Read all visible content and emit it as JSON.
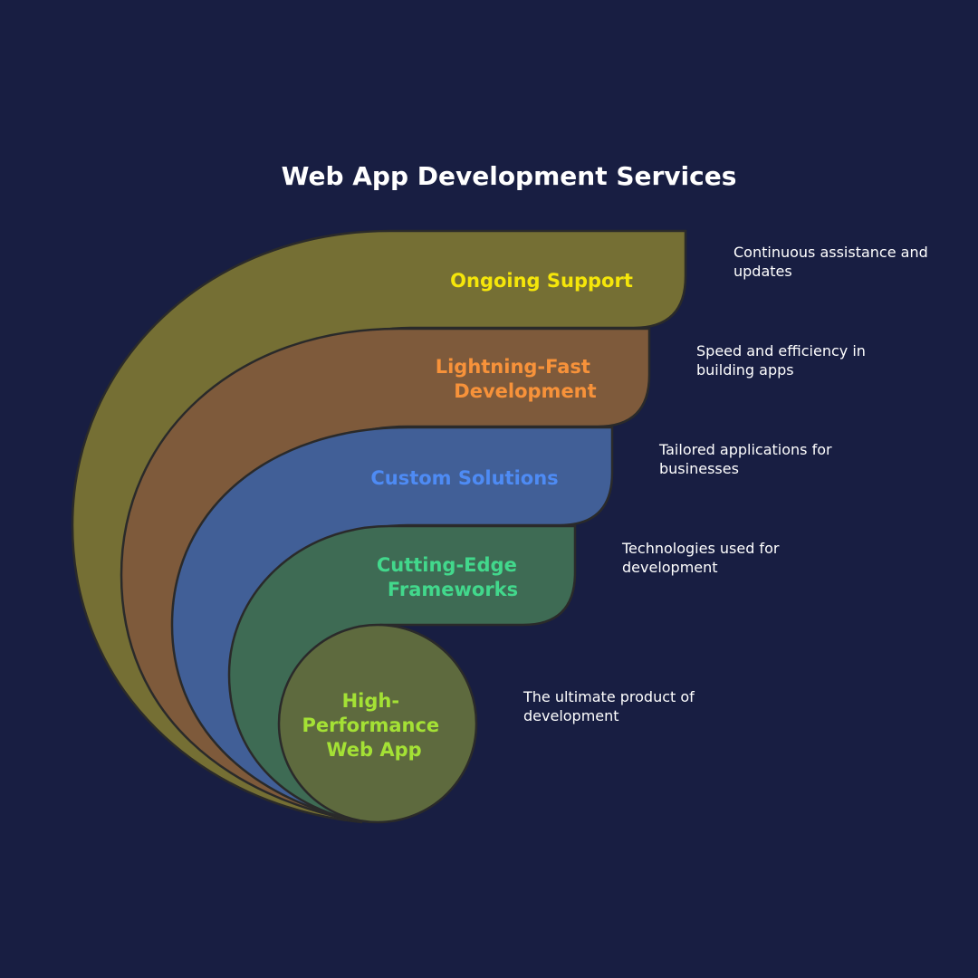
{
  "title": "Web App Development Services",
  "layers": [
    {
      "label_lines": [
        "Ongoing Support"
      ],
      "description_lines": [
        "Continuous assistance and",
        "updates"
      ],
      "fill": "#756f34",
      "label_color": "#f5e60a"
    },
    {
      "label_lines": [
        "Lightning-Fast",
        "Development"
      ],
      "description_lines": [
        "Speed and efficiency in",
        "building apps"
      ],
      "fill": "#7e5a3b",
      "label_color": "#f7923a"
    },
    {
      "label_lines": [
        "Custom Solutions"
      ],
      "description_lines": [
        "Tailored applications for",
        "businesses"
      ],
      "fill": "#415f97",
      "label_color": "#4e8bf4"
    },
    {
      "label_lines": [
        "Cutting-Edge",
        "Frameworks"
      ],
      "description_lines": [
        "Technologies used for",
        "development"
      ],
      "fill": "#3e6b54",
      "label_color": "#42d88c"
    },
    {
      "label_lines": [
        "High-",
        "Performance",
        "Web App"
      ],
      "description_lines": [
        "The ultimate product of",
        "development"
      ],
      "fill": "#5e6a3e",
      "label_color": "#a4e135"
    }
  ]
}
